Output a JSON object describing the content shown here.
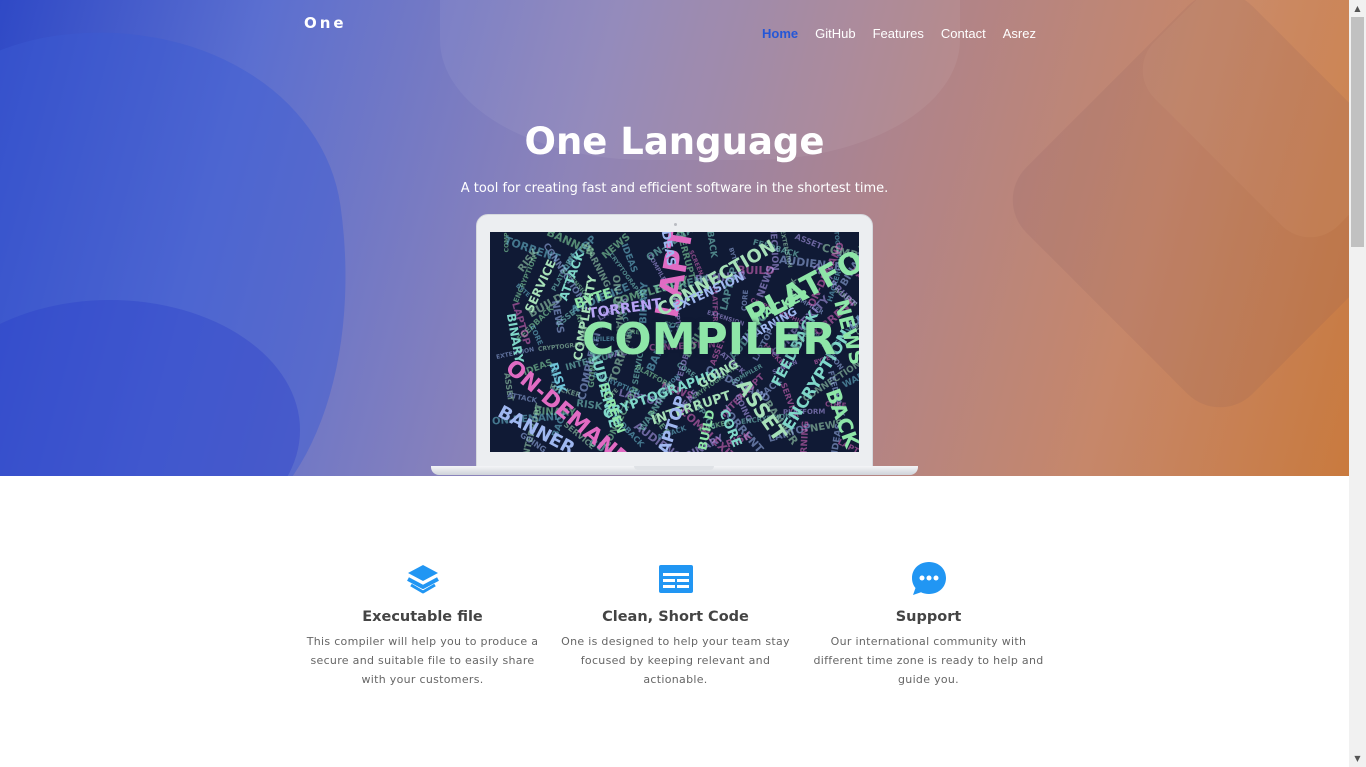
{
  "brand": "One",
  "nav": {
    "items": [
      {
        "label": "Home",
        "active": true
      },
      {
        "label": "GitHub",
        "active": false
      },
      {
        "label": "Features",
        "active": false
      },
      {
        "label": "Contact",
        "active": false
      },
      {
        "label": "Asrez",
        "active": false
      }
    ]
  },
  "hero": {
    "title": "One Language",
    "subtitle": "A tool for creating fast and efficient software in the shortest time."
  },
  "laptop_image": {
    "description_words": [
      "COMPILER",
      "PLATFORM",
      "LAPTOP",
      "CONNECTION",
      "ON-DEMAND",
      "BANNER",
      "CRYPTOGRAPHIC",
      "ENCRYPTION",
      "ASSET",
      "BACK",
      "NEWS",
      "TORRENT",
      "EXTENSION",
      "HACKER",
      "FEEDBACK",
      "INTERRUPT",
      "LAPTOP",
      "COMPLEXITY",
      "BYTE",
      "ATTACK",
      "SERVICE",
      "IDEAS",
      "RISK",
      "AUDIENCE",
      "SCREEN",
      "CORE",
      "GOING",
      "WARNING",
      "BINARY",
      "BUILD"
    ]
  },
  "features": [
    {
      "icon": "layers-icon",
      "title": "Executable file",
      "text": "This compiler will help you to produce a secure and suitable file to easily share with your customers."
    },
    {
      "icon": "browser-window-icon",
      "title": "Clean, Short Code",
      "text": "One is designed to help your team stay focused by keeping relevant and actionable."
    },
    {
      "icon": "chat-bubble-icon",
      "title": "Support",
      "text": "Our international community with different time zone is ready to help and guide you."
    }
  ],
  "colors": {
    "accent_blue": "#2196f3",
    "nav_active": "#2557d6",
    "gradient_left": "#2f49c6",
    "gradient_right": "#c97a3e"
  }
}
